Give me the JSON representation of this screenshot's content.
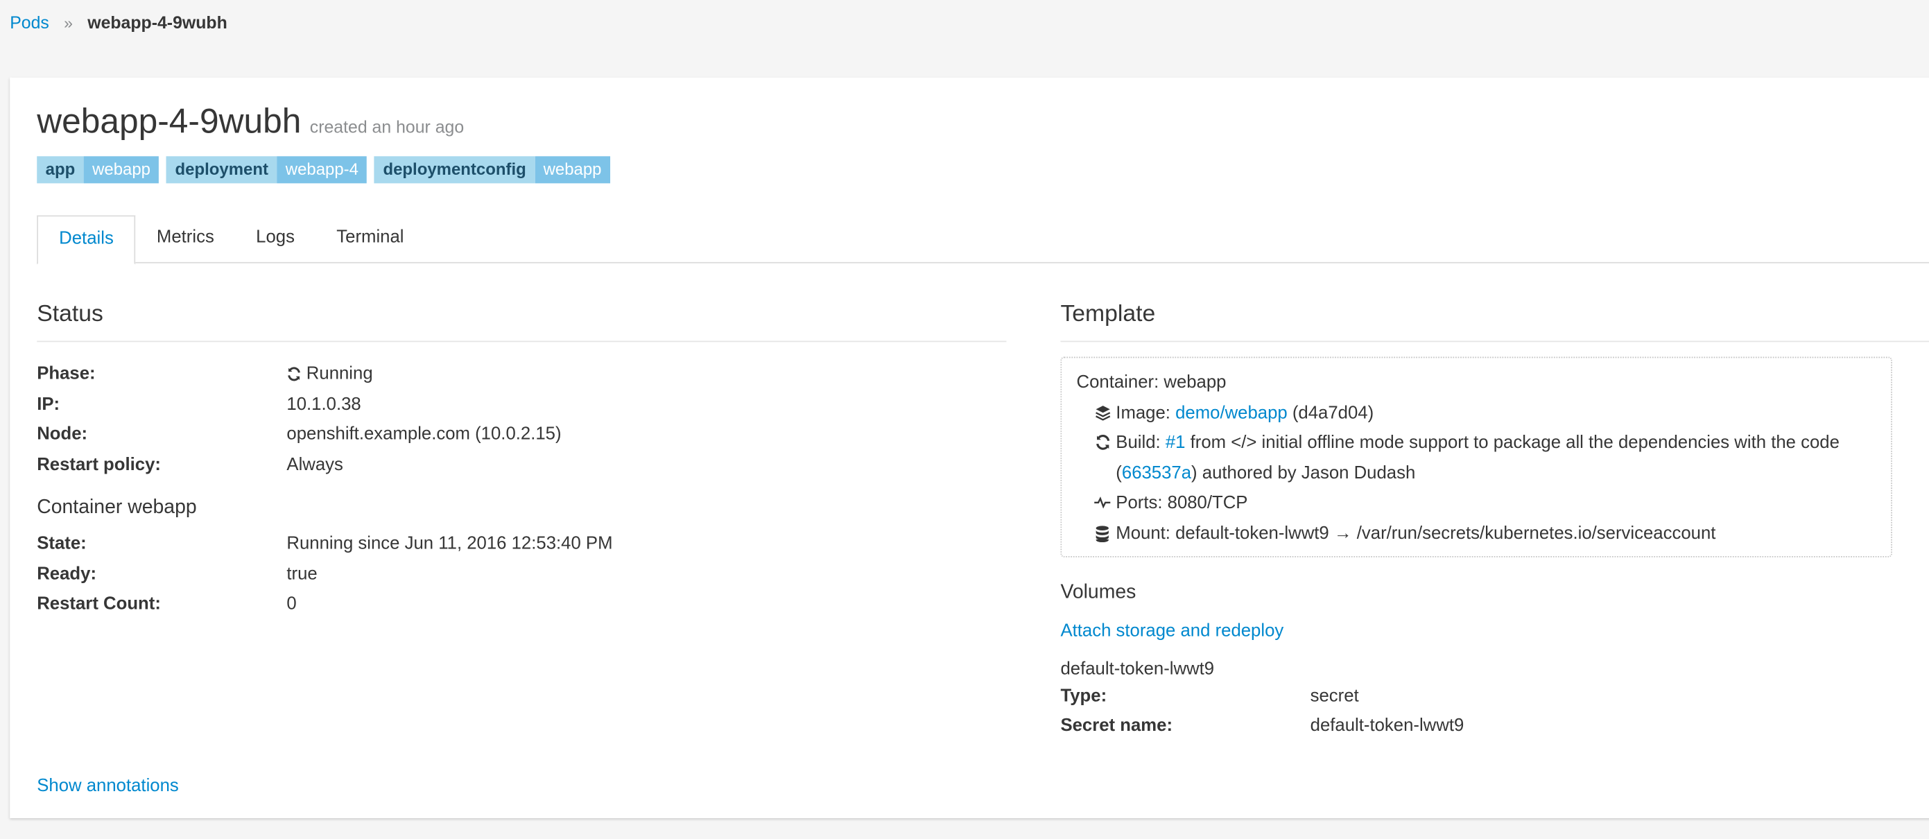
{
  "breadcrumb": {
    "parent": "Pods",
    "separator": "»",
    "current": "webapp-4-9wubh"
  },
  "header": {
    "title": "webapp-4-9wubh",
    "created": "created an hour ago"
  },
  "labels": [
    {
      "key": "app",
      "value": "webapp"
    },
    {
      "key": "deployment",
      "value": "webapp-4"
    },
    {
      "key": "deploymentconfig",
      "value": "webapp"
    }
  ],
  "tabs": [
    {
      "label": "Details",
      "active": true
    },
    {
      "label": "Metrics",
      "active": false
    },
    {
      "label": "Logs",
      "active": false
    },
    {
      "label": "Terminal",
      "active": false
    }
  ],
  "status": {
    "title": "Status",
    "rows": [
      {
        "key": "Phase:",
        "value": "Running"
      },
      {
        "key": "IP:",
        "value": "10.1.0.38"
      },
      {
        "key": "Node:",
        "value": "openshift.example.com (10.0.2.15)"
      },
      {
        "key": "Restart policy:",
        "value": "Always"
      }
    ],
    "container_title": "Container webapp",
    "container_rows": [
      {
        "key": "State:",
        "value": "Running since Jun 11, 2016 12:53:40 PM"
      },
      {
        "key": "Ready:",
        "value": "true"
      },
      {
        "key": "Restart Count:",
        "value": "0"
      }
    ]
  },
  "template": {
    "title": "Template",
    "container": "Container: webapp",
    "image_prefix": "Image: ",
    "image_link": "demo/webapp",
    "image_suffix": " (d4a7d04)",
    "build_prefix": "Build: ",
    "build_link": "#1",
    "build_mid": " from </> initial offline mode support to package all the dependencies with the code (",
    "commit_link": "663537a",
    "build_suffix": ") authored by Jason Dudash",
    "ports": "Ports: 8080/TCP",
    "mount": "Mount: default-token-lwwt9 → /var/run/secrets/kubernetes.io/serviceaccount"
  },
  "volumes": {
    "title": "Volumes",
    "attach_link": "Attach storage and redeploy",
    "name": "default-token-lwwt9",
    "type_key": "Type:",
    "type_value": "secret",
    "secret_key": "Secret name:",
    "secret_value": "default-token-lwwt9"
  },
  "footer": {
    "show_annotations": "Show annotations"
  },
  "colors": {
    "link": "#0088ce",
    "label_key_bg": "#a8d9ee",
    "label_value_bg": "#7dc3e8"
  },
  "icons": {
    "phase": "refresh-icon",
    "image": "layers-icon",
    "build": "refresh-icon",
    "ports": "pulse-icon",
    "mount": "database-icon"
  }
}
